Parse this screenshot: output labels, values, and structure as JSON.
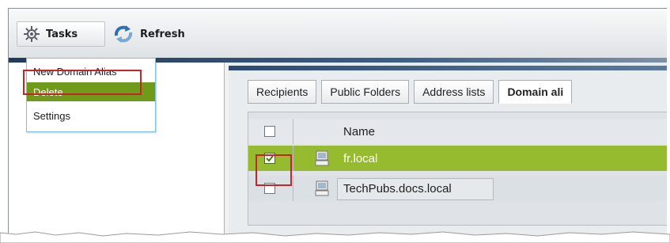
{
  "toolbar": {
    "tasks_label": "Tasks",
    "refresh_label": "Refresh"
  },
  "tasks_menu": {
    "items": [
      {
        "label": "New Domain Alias"
      },
      {
        "label": "Delete",
        "highlighted": true
      },
      {
        "label": "Settings"
      }
    ]
  },
  "tabs": [
    {
      "label": "Recipients",
      "active": false
    },
    {
      "label": "Public Folders",
      "active": false
    },
    {
      "label": "Address lists",
      "active": false
    },
    {
      "label": "Domain ali",
      "active": true
    }
  ],
  "grid": {
    "columns": [
      "Name"
    ],
    "rows": [
      {
        "name": "fr.local",
        "checked": true,
        "selected": true
      },
      {
        "name": "TechPubs.docs.local",
        "checked": false,
        "selected": false
      }
    ]
  },
  "colors": {
    "selection_green": "#97bb2e",
    "menu_highlight": "#6f9a1a",
    "annotation_red": "#c8222b",
    "band_blue": "#2c4a70"
  },
  "icons": [
    "gear-icon",
    "refresh-icon",
    "domain-icon"
  ]
}
